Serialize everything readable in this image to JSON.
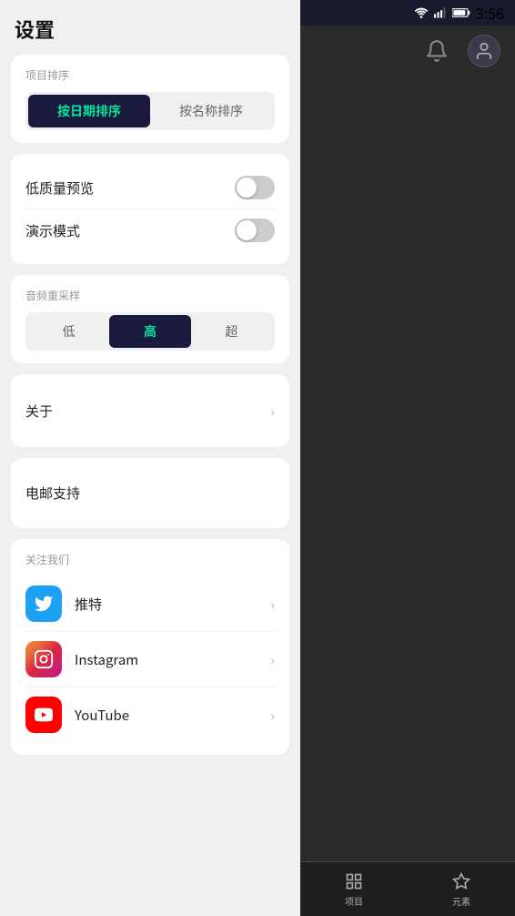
{
  "statusBar": {
    "time": "3:56"
  },
  "settings": {
    "title": "设置",
    "sortSection": {
      "label": "项目排序",
      "byDateButton": "按日期排序",
      "byNameButton": "按名称排序",
      "activeSort": "date"
    },
    "qualitySection": {
      "lowQualityPreview": "低质量预览",
      "demoMode": "演示模式"
    },
    "audioSection": {
      "label": "音频重采样",
      "options": [
        "低",
        "高",
        "超"
      ],
      "activeOption": 1
    },
    "aboutItem": {
      "label": "关于"
    },
    "emailItem": {
      "label": "电邮支持"
    },
    "followSection": {
      "label": "关注我们",
      "items": [
        {
          "name": "推特",
          "platform": "twitter"
        },
        {
          "name": "Instagram",
          "platform": "instagram"
        },
        {
          "name": "YouTube",
          "platform": "youtube"
        }
      ]
    }
  },
  "rightPanel": {
    "bottomNav": [
      {
        "label": "项目",
        "icon": "grid"
      },
      {
        "label": "元素",
        "icon": "layers"
      }
    ]
  }
}
